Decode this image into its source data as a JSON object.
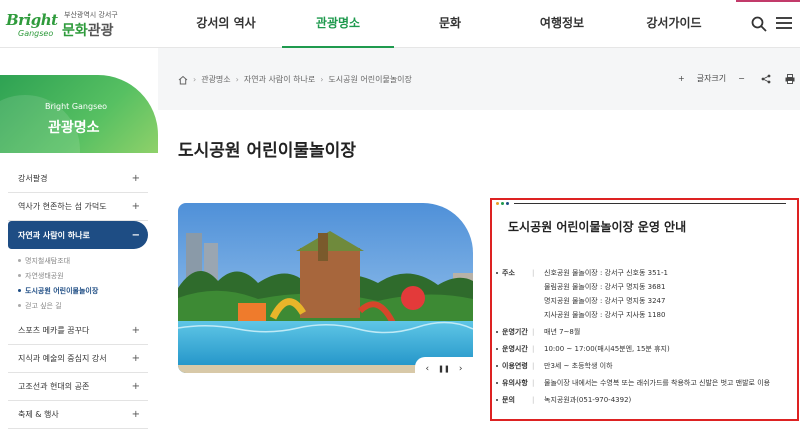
{
  "header": {
    "logo_brand": "Bright",
    "logo_brand_sub": "Gangseo",
    "logo_sub": "부산광역시 강서구",
    "logo_main_a": "문화",
    "logo_main_b": "관광",
    "nav": [
      "강서의 역사",
      "관광명소",
      "문화",
      "여행정보",
      "강서가이드"
    ],
    "nav_active_index": 1
  },
  "sidebar": {
    "banner_eng": "Bright Gangseo",
    "banner_kor": "관광명소",
    "items": [
      {
        "label": "강서팔경",
        "toggle": "+"
      },
      {
        "label": "역사가 현존하는 섬 가덕도",
        "toggle": "+"
      },
      {
        "label": "자연과 사람이 하나로",
        "toggle": "−"
      },
      {
        "label": "스포츠 메카를 꿈꾸다",
        "toggle": "+"
      },
      {
        "label": "지식과 예술의 중심지 강서",
        "toggle": "+"
      },
      {
        "label": "고조선과 현대의 공존",
        "toggle": "+"
      },
      {
        "label": "축제 & 행사",
        "toggle": "+"
      }
    ],
    "sub_items": [
      "명지철새탐조대",
      "자연생태공원",
      "도시공원 어린이물놀이장",
      "걷고 싶은 길"
    ]
  },
  "breadcrumb": [
    "관광명소",
    "자연과 사람이 하나로",
    "도시공원 어린이물놀이장"
  ],
  "tools": {
    "plus": "+",
    "font_label": "글자크기",
    "minus": "−"
  },
  "page_title": "도시공원 어린이물놀이장",
  "slider": {
    "prev": "‹",
    "pause": "❚❚",
    "next": "›"
  },
  "info": {
    "title": "도시공원 어린이물놀이장 운영 안내",
    "rows": [
      {
        "label": "주소",
        "values": [
          "신호공원 물놀이장 : 강서구 신호동 351-1",
          "물림공원 물놀이장 : 강서구 명지동 3681",
          "명지공원 물놀이장 : 강서구 명지동 3247",
          "지사공원 물놀이장 : 강서구 지사동 1180"
        ]
      },
      {
        "label": "운영기간",
        "values": [
          "매년 7~8월"
        ]
      },
      {
        "label": "운영시간",
        "values": [
          "10:00 ~ 17:00(매시45분엔, 15분 휴지)"
        ]
      },
      {
        "label": "이용연령",
        "values": [
          "만3세 ~ 초등학생 이하"
        ]
      },
      {
        "label": "유의사항",
        "values": [
          "물놀이장 내에서는 수영복 또는 래쉬가드를 착용하고 신발은 벗고 맨발로 이용"
        ]
      },
      {
        "label": "문의",
        "values": [
          "녹지공원과(051-970-4392)"
        ]
      }
    ]
  },
  "colors": {
    "brand_green": "#1f9a4e",
    "side_active": "#1e4d84",
    "highlight_border": "#dd2222"
  }
}
